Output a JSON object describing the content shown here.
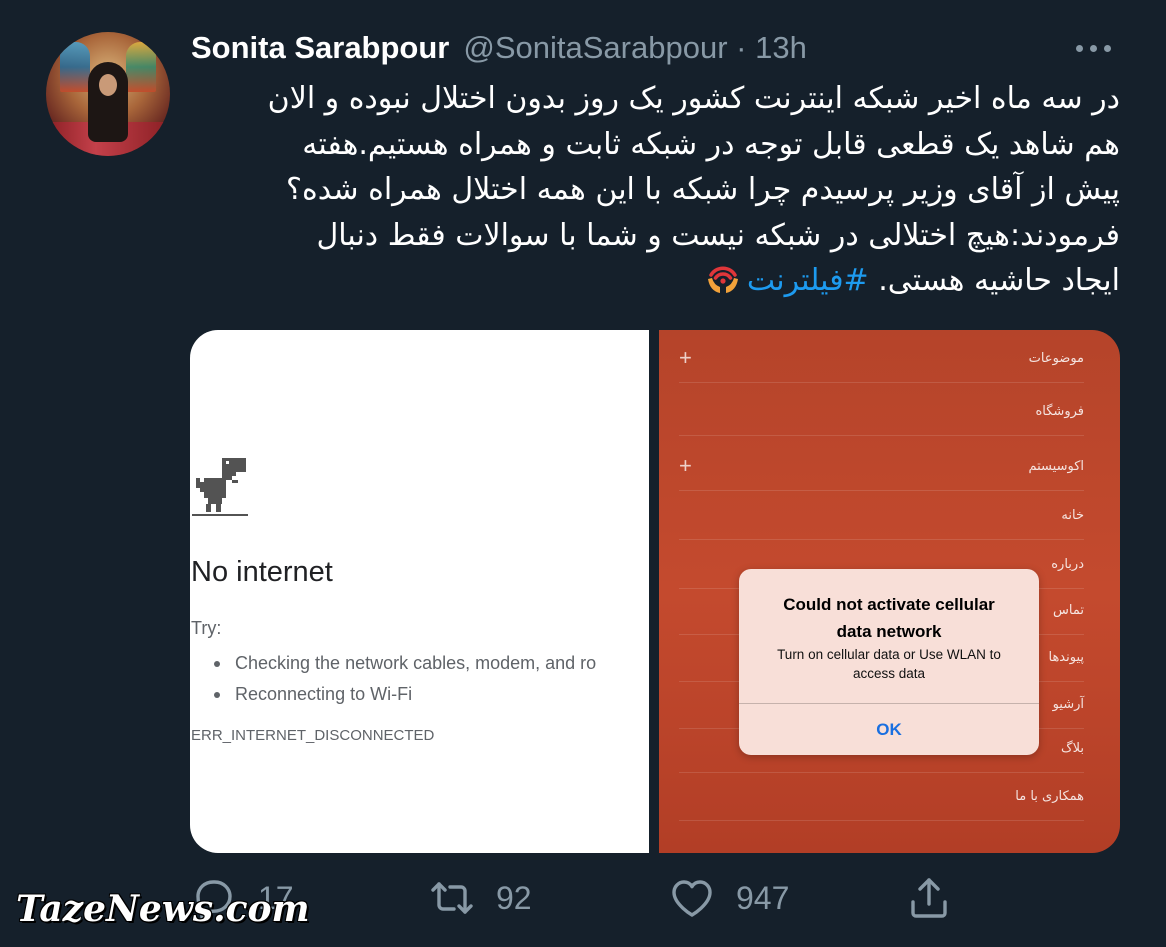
{
  "tweet": {
    "display_name": "Sonita Sarabpour",
    "handle": "@SonitaSarabpour",
    "separator": "·",
    "time": "13h",
    "more_icon": "more-horizontal-icon",
    "text_lines": [
      "در سه ماه اخیر شبکه اینترنت کشور یک روز بدون اختلال نبوده و الان",
      "هم شاهد یک قطعی قابل توجه در شبکه ثابت و همراه هستیم.هفته",
      "پیش از آقای وزیر پرسیدم چرا شبکه با این همه اختلال همراه شده؟",
      "فرمودند:هیچ اختلالی در شبکه نیست و شما با سوالات فقط دنبال"
    ],
    "text_last_line": "ایجاد حاشیه هستی.",
    "hashtag": "#فیلترنت",
    "hashtag_emoji": "wifi-hands-emoji"
  },
  "media": {
    "left": {
      "dino_icon": "dino-icon",
      "title": "No internet",
      "try_label": "Try:",
      "suggestions": [
        "Checking the network cables, modem, and ro",
        "Reconnecting to Wi-Fi"
      ],
      "error_code": "ERR_INTERNET_DISCONNECTED"
    },
    "right": {
      "menu_items": [
        {
          "label": "موضوعات",
          "plus": "+"
        },
        {
          "label": "فروشگاه",
          "plus": ""
        },
        {
          "label": "اکوسیستم",
          "plus": "+"
        },
        {
          "label": "خانه",
          "plus": ""
        },
        {
          "label": "درباره",
          "plus": ""
        },
        {
          "label": "تماس",
          "plus": ""
        },
        {
          "label": "پیوندها",
          "plus": ""
        },
        {
          "label": "آرشیو",
          "plus": ""
        },
        {
          "label": "بلاگ",
          "plus": ""
        },
        {
          "label": "همکاری با ما",
          "plus": ""
        }
      ],
      "dialog": {
        "title_line1": "Could not activate cellular",
        "title_line2": "data network",
        "body_line1": "Turn on cellular data or Use WLAN to",
        "body_line2": "access data",
        "ok_label": "OK"
      }
    }
  },
  "actions": {
    "reply": {
      "icon": "reply-icon",
      "count": "17"
    },
    "retweet": {
      "icon": "retweet-icon",
      "count": "92"
    },
    "like": {
      "icon": "heart-icon",
      "count": "947"
    },
    "share": {
      "icon": "share-icon"
    }
  },
  "watermark": "TazeNews.com",
  "colors": {
    "background": "#15202b",
    "secondary_text": "#8899a6",
    "link": "#1d9bf0",
    "dialog_ok": "#1a6fe0"
  }
}
